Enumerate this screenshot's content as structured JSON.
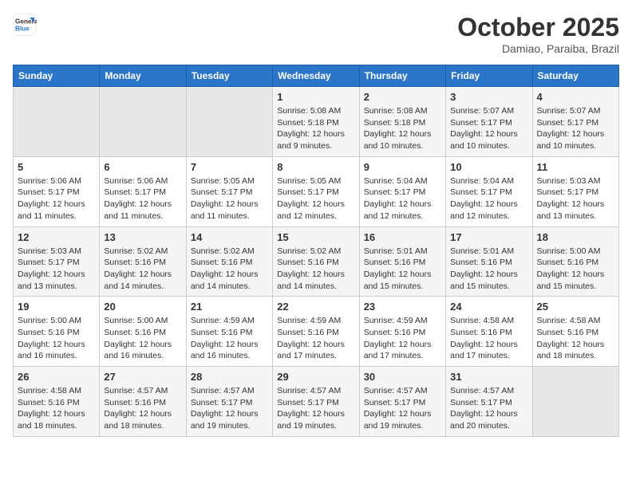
{
  "header": {
    "logo_line1": "General",
    "logo_line2": "Blue",
    "month": "October 2025",
    "location": "Damiao, Paraiba, Brazil"
  },
  "weekdays": [
    "Sunday",
    "Monday",
    "Tuesday",
    "Wednesday",
    "Thursday",
    "Friday",
    "Saturday"
  ],
  "weeks": [
    [
      {
        "day": "",
        "info": ""
      },
      {
        "day": "",
        "info": ""
      },
      {
        "day": "",
        "info": ""
      },
      {
        "day": "1",
        "info": "Sunrise: 5:08 AM\nSunset: 5:18 PM\nDaylight: 12 hours\nand 9 minutes."
      },
      {
        "day": "2",
        "info": "Sunrise: 5:08 AM\nSunset: 5:18 PM\nDaylight: 12 hours\nand 10 minutes."
      },
      {
        "day": "3",
        "info": "Sunrise: 5:07 AM\nSunset: 5:17 PM\nDaylight: 12 hours\nand 10 minutes."
      },
      {
        "day": "4",
        "info": "Sunrise: 5:07 AM\nSunset: 5:17 PM\nDaylight: 12 hours\nand 10 minutes."
      }
    ],
    [
      {
        "day": "5",
        "info": "Sunrise: 5:06 AM\nSunset: 5:17 PM\nDaylight: 12 hours\nand 11 minutes."
      },
      {
        "day": "6",
        "info": "Sunrise: 5:06 AM\nSunset: 5:17 PM\nDaylight: 12 hours\nand 11 minutes."
      },
      {
        "day": "7",
        "info": "Sunrise: 5:05 AM\nSunset: 5:17 PM\nDaylight: 12 hours\nand 11 minutes."
      },
      {
        "day": "8",
        "info": "Sunrise: 5:05 AM\nSunset: 5:17 PM\nDaylight: 12 hours\nand 12 minutes."
      },
      {
        "day": "9",
        "info": "Sunrise: 5:04 AM\nSunset: 5:17 PM\nDaylight: 12 hours\nand 12 minutes."
      },
      {
        "day": "10",
        "info": "Sunrise: 5:04 AM\nSunset: 5:17 PM\nDaylight: 12 hours\nand 12 minutes."
      },
      {
        "day": "11",
        "info": "Sunrise: 5:03 AM\nSunset: 5:17 PM\nDaylight: 12 hours\nand 13 minutes."
      }
    ],
    [
      {
        "day": "12",
        "info": "Sunrise: 5:03 AM\nSunset: 5:17 PM\nDaylight: 12 hours\nand 13 minutes."
      },
      {
        "day": "13",
        "info": "Sunrise: 5:02 AM\nSunset: 5:16 PM\nDaylight: 12 hours\nand 14 minutes."
      },
      {
        "day": "14",
        "info": "Sunrise: 5:02 AM\nSunset: 5:16 PM\nDaylight: 12 hours\nand 14 minutes."
      },
      {
        "day": "15",
        "info": "Sunrise: 5:02 AM\nSunset: 5:16 PM\nDaylight: 12 hours\nand 14 minutes."
      },
      {
        "day": "16",
        "info": "Sunrise: 5:01 AM\nSunset: 5:16 PM\nDaylight: 12 hours\nand 15 minutes."
      },
      {
        "day": "17",
        "info": "Sunrise: 5:01 AM\nSunset: 5:16 PM\nDaylight: 12 hours\nand 15 minutes."
      },
      {
        "day": "18",
        "info": "Sunrise: 5:00 AM\nSunset: 5:16 PM\nDaylight: 12 hours\nand 15 minutes."
      }
    ],
    [
      {
        "day": "19",
        "info": "Sunrise: 5:00 AM\nSunset: 5:16 PM\nDaylight: 12 hours\nand 16 minutes."
      },
      {
        "day": "20",
        "info": "Sunrise: 5:00 AM\nSunset: 5:16 PM\nDaylight: 12 hours\nand 16 minutes."
      },
      {
        "day": "21",
        "info": "Sunrise: 4:59 AM\nSunset: 5:16 PM\nDaylight: 12 hours\nand 16 minutes."
      },
      {
        "day": "22",
        "info": "Sunrise: 4:59 AM\nSunset: 5:16 PM\nDaylight: 12 hours\nand 17 minutes."
      },
      {
        "day": "23",
        "info": "Sunrise: 4:59 AM\nSunset: 5:16 PM\nDaylight: 12 hours\nand 17 minutes."
      },
      {
        "day": "24",
        "info": "Sunrise: 4:58 AM\nSunset: 5:16 PM\nDaylight: 12 hours\nand 17 minutes."
      },
      {
        "day": "25",
        "info": "Sunrise: 4:58 AM\nSunset: 5:16 PM\nDaylight: 12 hours\nand 18 minutes."
      }
    ],
    [
      {
        "day": "26",
        "info": "Sunrise: 4:58 AM\nSunset: 5:16 PM\nDaylight: 12 hours\nand 18 minutes."
      },
      {
        "day": "27",
        "info": "Sunrise: 4:57 AM\nSunset: 5:16 PM\nDaylight: 12 hours\nand 18 minutes."
      },
      {
        "day": "28",
        "info": "Sunrise: 4:57 AM\nSunset: 5:17 PM\nDaylight: 12 hours\nand 19 minutes."
      },
      {
        "day": "29",
        "info": "Sunrise: 4:57 AM\nSunset: 5:17 PM\nDaylight: 12 hours\nand 19 minutes."
      },
      {
        "day": "30",
        "info": "Sunrise: 4:57 AM\nSunset: 5:17 PM\nDaylight: 12 hours\nand 19 minutes."
      },
      {
        "day": "31",
        "info": "Sunrise: 4:57 AM\nSunset: 5:17 PM\nDaylight: 12 hours\nand 20 minutes."
      },
      {
        "day": "",
        "info": ""
      }
    ]
  ]
}
